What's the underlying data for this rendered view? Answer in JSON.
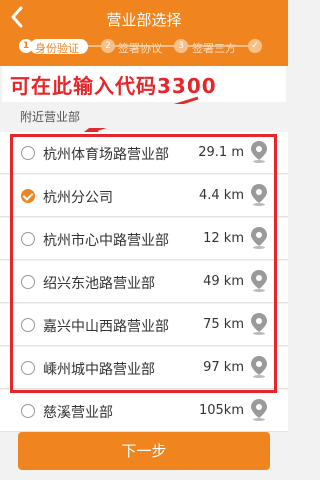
{
  "header": {
    "title": "营业部选择"
  },
  "steps": [
    {
      "number": "1",
      "label": "身份验证"
    },
    {
      "number": "2",
      "label": "签署协议"
    },
    {
      "number": "3",
      "label": "签署三方"
    }
  ],
  "hint": {
    "text": "可在此输入代码3300"
  },
  "section": {
    "label": "附近营业部"
  },
  "branches": [
    {
      "name": "杭州体育场路营业部",
      "distance": "29.1 m",
      "selected": false
    },
    {
      "name": "杭州分公司",
      "distance": "4.4 km",
      "selected": true
    },
    {
      "name": "杭州市心中路营业部",
      "distance": "12 km",
      "selected": false
    },
    {
      "name": "绍兴东池路营业部",
      "distance": "49 km",
      "selected": false
    },
    {
      "name": "嘉兴中山西路营业部",
      "distance": "75 km",
      "selected": false
    },
    {
      "name": "嵊州城中路营业部",
      "distance": "97 km",
      "selected": false
    },
    {
      "name": "慈溪营业部",
      "distance": "105km",
      "selected": false
    }
  ],
  "footer": {
    "next_label": "下一步"
  },
  "colors": {
    "accent": "#f08520",
    "annotation": "#e5262a"
  }
}
